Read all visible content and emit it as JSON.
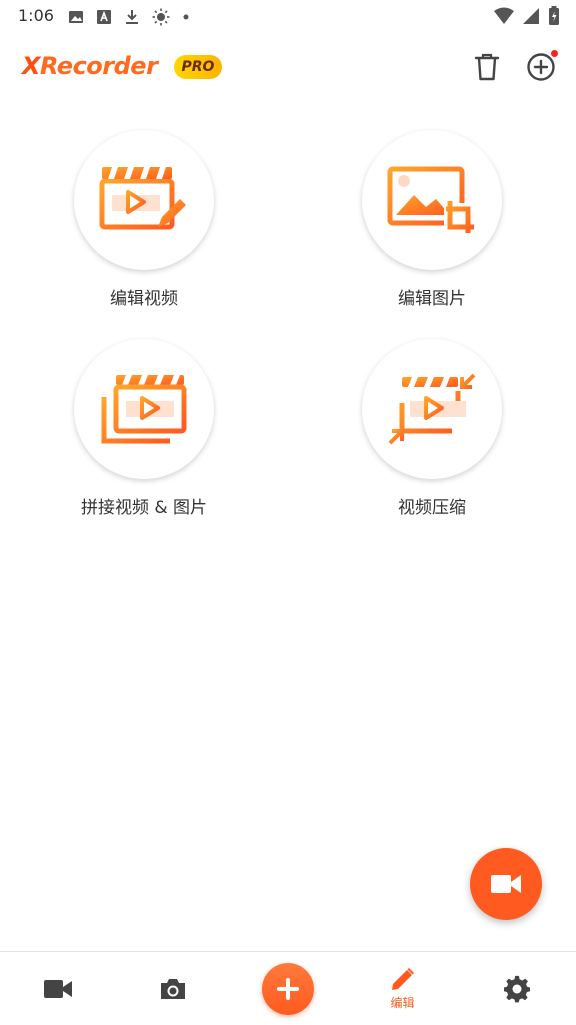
{
  "status_bar": {
    "time": "1:06"
  },
  "app_bar": {
    "logo_x": "X",
    "logo_rest": "Recorder",
    "pro_badge": "PRO"
  },
  "tools": [
    {
      "label": "编辑视频",
      "icon": "edit-video-icon"
    },
    {
      "label": "编辑图片",
      "icon": "edit-image-icon"
    },
    {
      "label": "拼接视频 & 图片",
      "icon": "merge-video-image-icon"
    },
    {
      "label": "视频压缩",
      "icon": "compress-video-icon"
    }
  ],
  "bottom_nav": {
    "items": [
      {
        "name": "video",
        "icon": "video-camera-icon",
        "label": ""
      },
      {
        "name": "screenshot",
        "icon": "camera-icon",
        "label": ""
      },
      {
        "name": "create",
        "icon": "plus-icon",
        "label": ""
      },
      {
        "name": "edit",
        "icon": "pencil-icon",
        "label": "编辑",
        "active": true
      },
      {
        "name": "settings",
        "icon": "gear-icon",
        "label": ""
      }
    ]
  },
  "colors": {
    "accent": "#ff5a1f",
    "pro_gold": "#ffc400",
    "notification": "#ff1e1e"
  }
}
